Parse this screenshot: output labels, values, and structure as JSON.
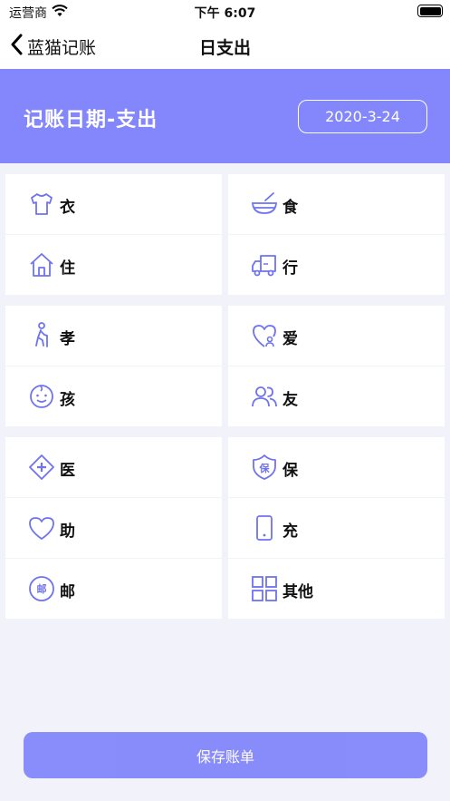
{
  "status": {
    "carrier": "运营商",
    "time": "下午 6:07"
  },
  "nav": {
    "back_label": "蓝猫记账",
    "title": "日支出"
  },
  "header": {
    "label": "记账日期-支出",
    "date": "2020-3-24"
  },
  "categories": {
    "yi": "衣",
    "shi": "食",
    "zhu": "住",
    "xing": "行",
    "xiao": "孝",
    "ai": "爱",
    "hai": "孩",
    "you": "友",
    "yiliao": "医",
    "bao": "保",
    "zhu2": "助",
    "chong": "充",
    "you2": "邮",
    "qita": "其他"
  },
  "icon_badges": {
    "bao": "保",
    "you2": "邮"
  },
  "colors": {
    "accent": "#8387fb",
    "icon": "#6f73ef"
  },
  "save_label": "保存账单"
}
